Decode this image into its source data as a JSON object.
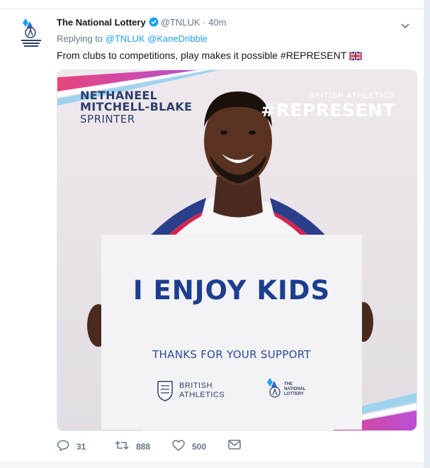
{
  "tweet": {
    "author_name": "The National Lottery",
    "handle": "@TNLUK",
    "separator": "·",
    "time": "40m",
    "replying_prefix": "Replying to",
    "replying_to": [
      "@TNLUK",
      "@KaneDribble"
    ],
    "text": "From clubs to competitions, play makes it possible #REPRESENT",
    "flag": "🇬🇧",
    "verified_icon": "verified-badge-icon",
    "menu_icon": "chevron-down-icon"
  },
  "media": {
    "athlete_first": "NETHANEEL",
    "athlete_last": "MITCHELL-BLAKE",
    "athlete_role": "SPRINTER",
    "brand_small": "BRITISH ATHLETICS",
    "hashtag": "#REPRESENT",
    "sign_main": "I ENJOY KIDS",
    "sign_thanks": "THANKS FOR YOUR SUPPORT",
    "logo1_line1": "BRITISH",
    "logo1_line2": "ATHLETICS",
    "logo2_line1": "THE",
    "logo2_line2": "NATIONAL",
    "logo2_line3": "LOTTERY"
  },
  "actions": {
    "reply_count": "31",
    "retweet_count": "888",
    "like_count": "500"
  },
  "colors": {
    "link": "#1da1f2",
    "muted": "#657786",
    "navy": "#2c3f6b",
    "accent_pink": "#e8457a"
  }
}
